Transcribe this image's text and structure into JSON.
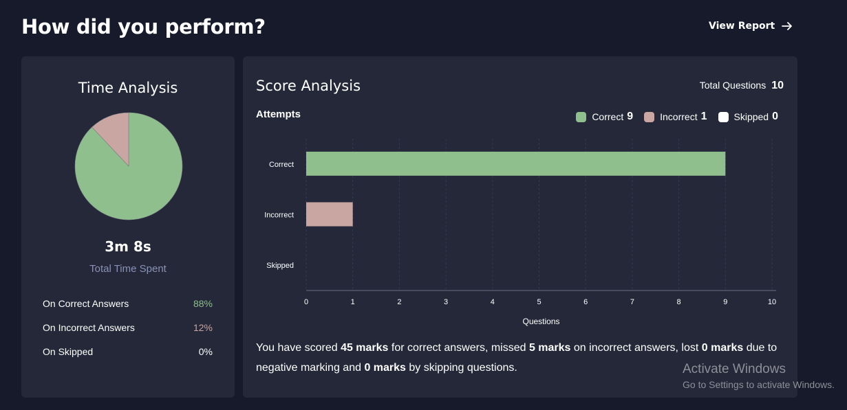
{
  "header": {
    "title": "How did you perform?",
    "view_report": "View Report",
    "arrow_icon": "arrow-right-icon"
  },
  "time_analysis": {
    "title": "Time Analysis",
    "total_time": "3m 8s",
    "total_label": "Total Time Spent",
    "pie": [
      {
        "name": "On Correct Answers",
        "percent": 88,
        "color": "#8fbf8c"
      },
      {
        "name": "On Incorrect Answers",
        "percent": 12,
        "color": "#c9a6a1"
      }
    ],
    "rows": [
      {
        "label": "On Correct Answers",
        "value": "88%",
        "color": "#8fbf8c"
      },
      {
        "label": "On Incorrect Answers",
        "value": "12%",
        "color": "#c9a6a1"
      },
      {
        "label": "On Skipped",
        "value": "0%",
        "color": "#ffffff"
      }
    ]
  },
  "score_analysis": {
    "title": "Score Analysis",
    "total_questions_label": "Total Questions",
    "total_questions": "10",
    "attempts_label": "Attempts",
    "legend": [
      {
        "label": "Correct",
        "count": "9",
        "color": "#8fbf8c"
      },
      {
        "label": "Incorrect",
        "count": "1",
        "color": "#c9a6a1"
      },
      {
        "label": "Skipped",
        "count": "0",
        "color": "#ffffff"
      }
    ],
    "summary": {
      "p1": "You have scored ",
      "b1": "45 marks",
      "p2": " for correct answers, missed ",
      "b2": "5 marks",
      "p3": " on incorrect answers, lost ",
      "b3": "0 marks",
      "p4": " due to negative marking and ",
      "b4": "0 marks",
      "p5": " by skipping questions."
    }
  },
  "chart_data": {
    "type": "bar",
    "orientation": "horizontal",
    "categories": [
      "Correct",
      "Incorrect",
      "Skipped"
    ],
    "values": [
      9,
      1,
      0
    ],
    "colors": [
      "#8fbf8c",
      "#c9a6a1",
      "#ffffff"
    ],
    "xlabel": "Questions",
    "ylabel": "",
    "xlim": [
      0,
      10
    ],
    "xticks": [
      "0",
      "1",
      "2",
      "3",
      "4",
      "5",
      "6",
      "7",
      "8",
      "9",
      "10"
    ],
    "grid": true
  },
  "watermark": {
    "title": "Activate Windows",
    "subtitle": "Go to Settings to activate Windows."
  }
}
